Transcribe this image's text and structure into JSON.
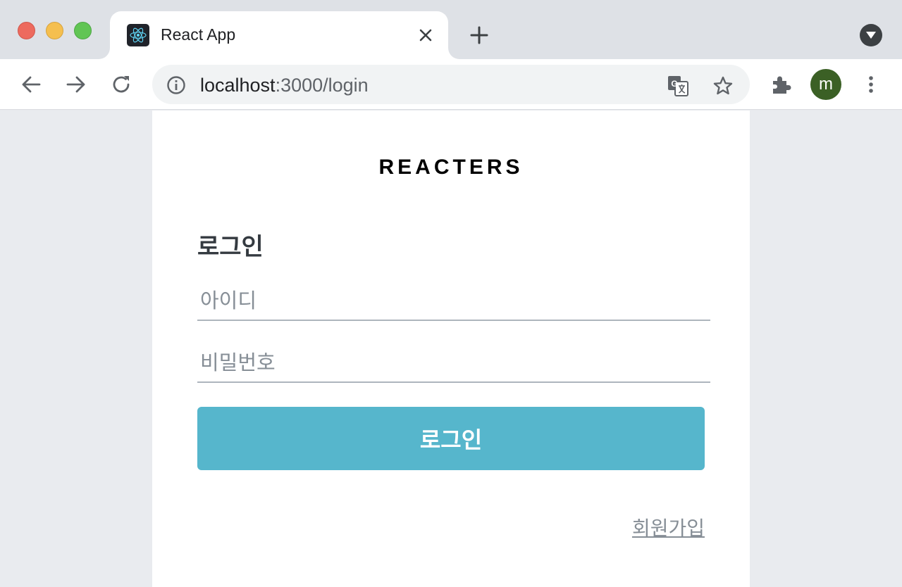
{
  "browser": {
    "tab_title": "React App",
    "url_host": "localhost",
    "url_rest": ":3000/login",
    "profile_initial": "m",
    "icons": [
      "react-favicon",
      "close-icon",
      "plus-icon",
      "chevron-down-icon",
      "back-arrow-icon",
      "forward-arrow-icon",
      "reload-icon",
      "info-icon",
      "translate-icon",
      "star-icon",
      "puzzle-icon",
      "more-vert-icon"
    ]
  },
  "page": {
    "logo": "REACTERS",
    "heading": "로그인",
    "username_placeholder": "아이디",
    "password_placeholder": "비밀번호",
    "submit_label": "로그인",
    "signup_link": "회원가입"
  },
  "colors": {
    "button": "#56b6cc",
    "avatar": "#3b6025",
    "background": "#e9ebef"
  }
}
